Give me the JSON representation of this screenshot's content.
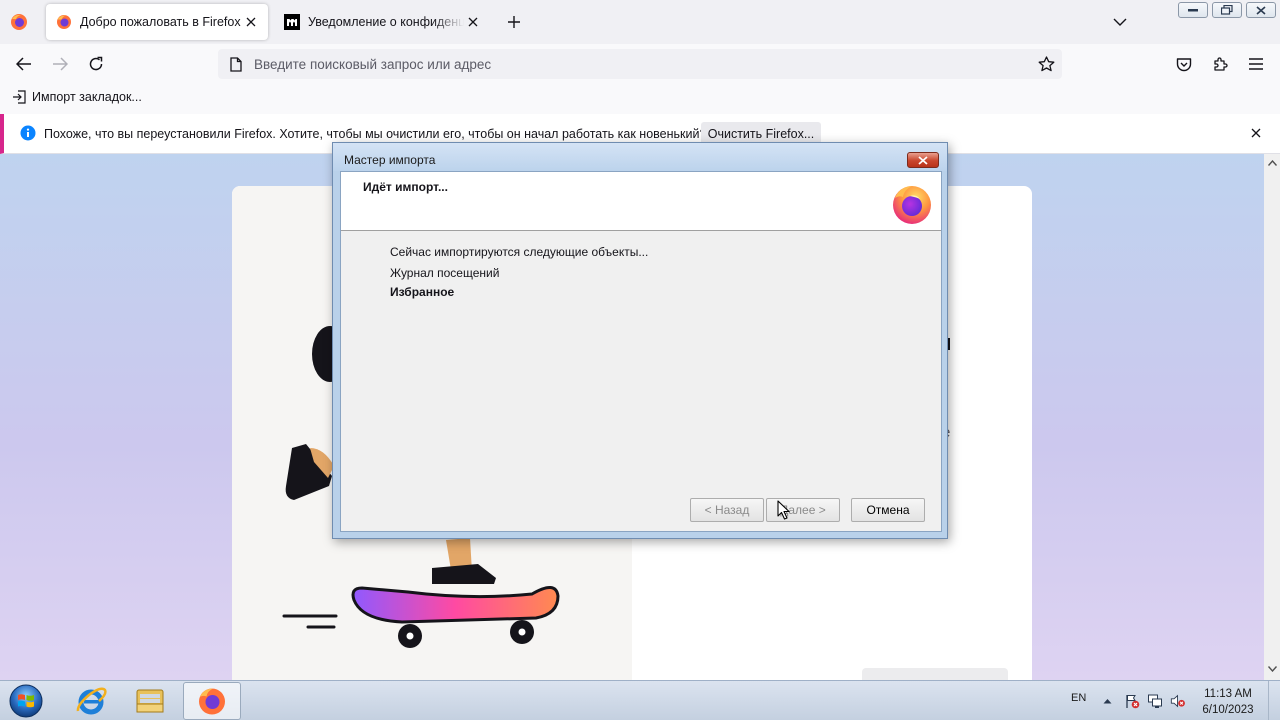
{
  "browser": {
    "tabs": [
      {
        "title": "Добро пожаловать в Firefox",
        "active": true,
        "icon": "firefox-icon"
      },
      {
        "title": "Уведомление о конфиденциальности",
        "active": false,
        "icon": "mozilla-m-icon"
      }
    ],
    "new_tab_icon": "plus-icon",
    "list_tabs_icon": "chevron-down-icon",
    "urlbar": {
      "placeholder": "Введите поисковый запрос или адрес",
      "value": ""
    },
    "bookmarks_bar": {
      "import_label": "Импорт закладок..."
    },
    "notification": {
      "message": "Похоже, что вы переустановили Firefox. Хотите, чтобы мы очистили его, чтобы он начал работать как новенький?",
      "button_label": "Очистить Firefox...",
      "accent_color": "#d7268c",
      "info_color": "#0a84ff"
    }
  },
  "page": {
    "fragment_text": "е"
  },
  "wizard": {
    "title": "Мастер импорта",
    "heading": "Идёт импорт...",
    "lines": [
      {
        "text": "Сейчас импортируются следующие объекты...",
        "bold": false
      },
      {
        "text": "Журнал посещений",
        "bold": false
      },
      {
        "text": "Избранное",
        "bold": true
      }
    ],
    "buttons": {
      "back": "< Назад",
      "next": "Далее >",
      "cancel": "Отмена"
    }
  },
  "taskbar": {
    "apps": [
      "internet-explorer-icon",
      "file-explorer-icon",
      "firefox-icon"
    ],
    "language": "EN",
    "clock": {
      "time": "11:13 AM",
      "date": "6/10/2023"
    }
  }
}
